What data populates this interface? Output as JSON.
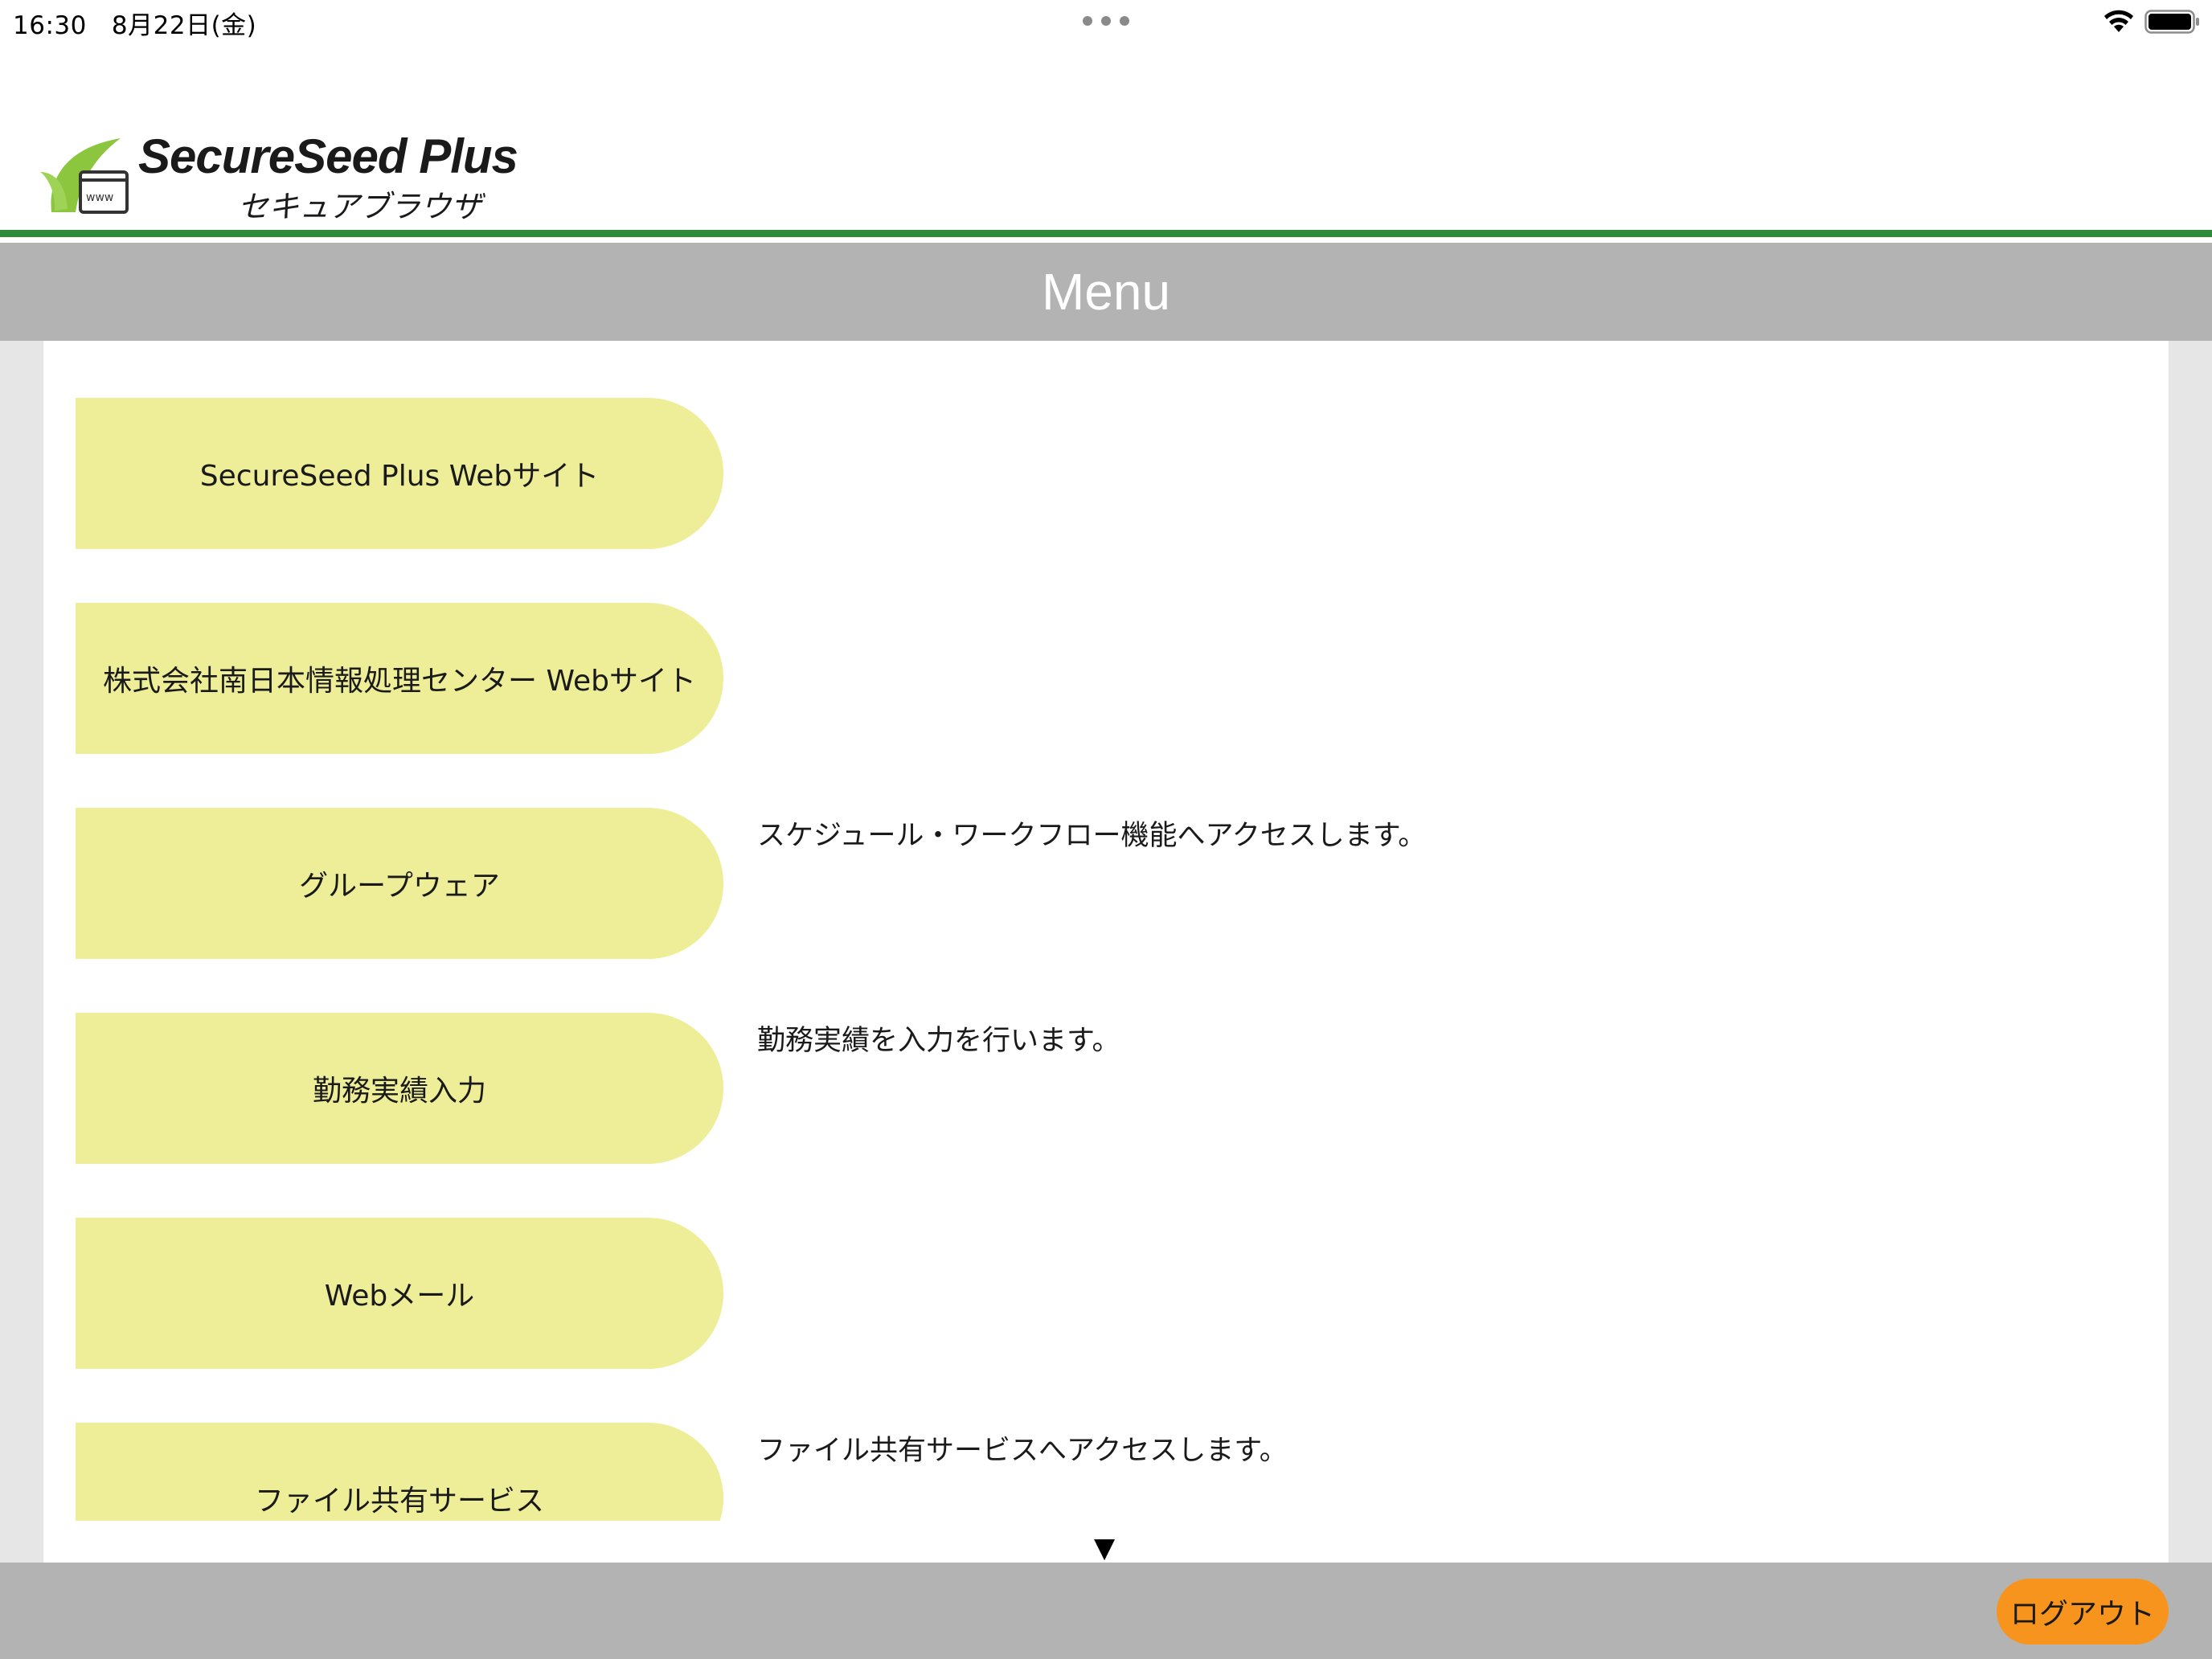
{
  "status_bar": {
    "time": "16:30",
    "date": "8月22日(金)",
    "dots": "•••"
  },
  "brand": {
    "name": "SecureSeed Plus",
    "subtitle": "セキュアブラウザ",
    "icon_text": "www",
    "green": "#2e8b3a",
    "leaf_green": "#8cc63f"
  },
  "header": {
    "title": "Menu"
  },
  "menu": {
    "items": [
      {
        "label": "SecureSeed Plus Webサイト",
        "description": ""
      },
      {
        "label": "株式会社南日本情報処理センター Webサイト",
        "description": ""
      },
      {
        "label": "グループウェア",
        "description": "スケジュール・ワークフロー機能へアクセスします。"
      },
      {
        "label": "勤務実績入力",
        "description": "勤務実績を入力を行います。"
      },
      {
        "label": "Webメール",
        "description": ""
      },
      {
        "label": "ファイル共有サービス",
        "description": "ファイル共有サービスへアクセスします。"
      }
    ],
    "button_color": "#eeee99",
    "scroll_indicator": "▼"
  },
  "footer": {
    "logout_label": "ログアウト",
    "logout_color": "#f7941d"
  }
}
